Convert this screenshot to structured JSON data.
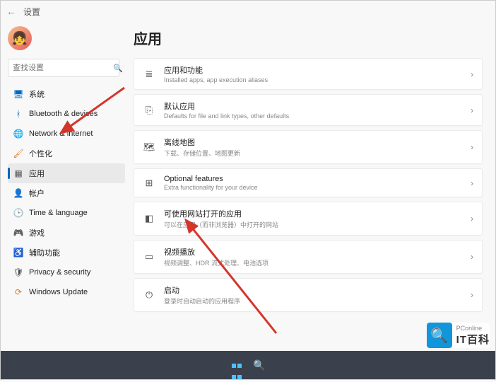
{
  "titlebar": {
    "back": "←",
    "title": "设置"
  },
  "search": {
    "placeholder": "查找设置"
  },
  "nav": [
    {
      "icon": "system",
      "label": "系统",
      "color": "#0067c0"
    },
    {
      "icon": "bt",
      "label": "Bluetooth & devices",
      "color": "#0067c0"
    },
    {
      "icon": "net",
      "label": "Network & internet",
      "color": "#2e9e3f"
    },
    {
      "icon": "pers",
      "label": "个性化",
      "color": "#d97b1f"
    },
    {
      "icon": "apps",
      "label": "应用",
      "color": "#555",
      "active": true
    },
    {
      "icon": "acct",
      "label": "帐户",
      "color": "#8a5a3b"
    },
    {
      "icon": "time",
      "label": "Time & language",
      "color": "#0067c0"
    },
    {
      "icon": "game",
      "label": "游戏",
      "color": "#7c7c7c"
    },
    {
      "icon": "access",
      "label": "辅助功能",
      "color": "#0067c0"
    },
    {
      "icon": "priv",
      "label": "Privacy & security",
      "color": "#4b4b4b"
    },
    {
      "icon": "update",
      "label": "Windows Update",
      "color": "#d97b1f"
    }
  ],
  "page": {
    "title": "应用"
  },
  "cards": [
    {
      "icon": "≣",
      "title": "应用和功能",
      "sub": "Installed apps, app execution aliases"
    },
    {
      "icon": "⎘",
      "title": "默认应用",
      "sub": "Defaults for file and link types, other defaults"
    },
    {
      "icon": "🗺",
      "title": "离线地图",
      "sub": "下载、存储位置、地图更新"
    },
    {
      "icon": "⊞",
      "title": "Optional features",
      "sub": "Extra functionality for your device"
    },
    {
      "icon": "◧",
      "title": "可使用网站打开的应用",
      "sub": "可以在应用（而非浏览器）中打开的网站"
    },
    {
      "icon": "▭",
      "title": "视频播放",
      "sub": "视频调整、HDR 流式处理、电池选项"
    },
    {
      "icon": "⏻",
      "title": "启动",
      "sub": "登录时自动启动的应用程序"
    }
  ],
  "watermark": {
    "small": "PConline",
    "big": "IT百科"
  }
}
